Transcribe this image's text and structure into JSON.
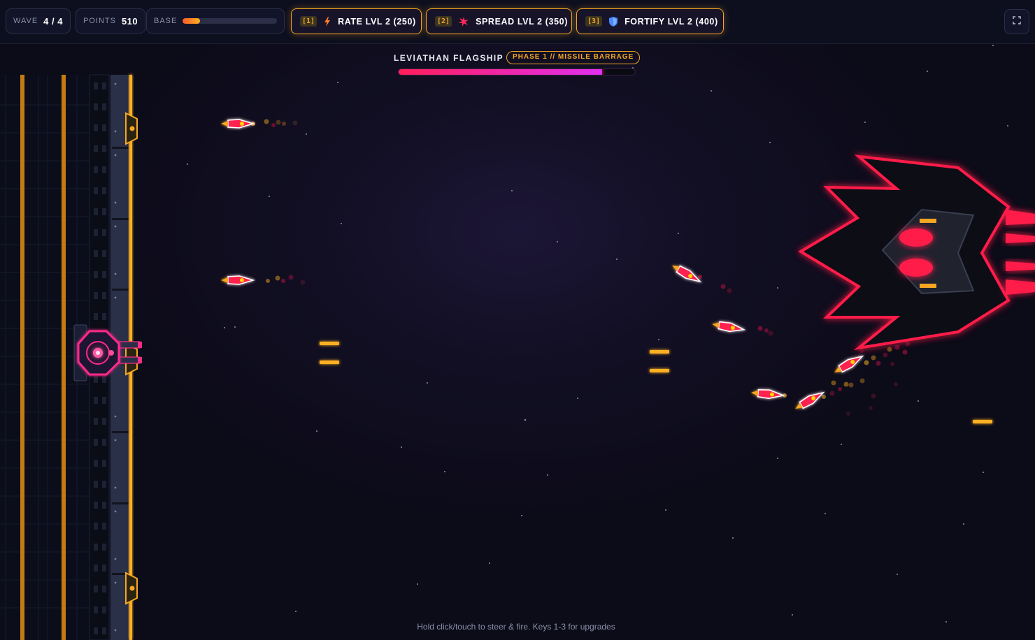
{
  "hud": {
    "wave": {
      "label": "WAVE",
      "value": "4 / 4"
    },
    "points": {
      "label": "POINTS",
      "value": "510"
    },
    "base": {
      "label": "BASE",
      "health_fraction": 0.18
    },
    "upgrades": [
      {
        "key": "[1]",
        "icon": "lightning-icon",
        "label": "RATE  LVL 2 (250)"
      },
      {
        "key": "[2]",
        "icon": "burst-icon",
        "label": "SPREAD  LVL 2 (350)"
      },
      {
        "key": "[3]",
        "icon": "shield-icon",
        "label": "FORTIFY  LVL 2 (400)"
      }
    ],
    "fullscreen_icon": "fullscreen-icon"
  },
  "boss": {
    "name": "LEVIATHAN FLAGSHIP",
    "phase": "PHASE 1 // MISSILE BARRAGE",
    "health_fraction": 0.86
  },
  "hint": "Hold click/touch to steer & fire. Keys 1-3 for upgrades",
  "colors": {
    "accent": "#f5a623",
    "enemy": "#ff1e5a",
    "boss_bar": "#e030f0",
    "background": "#0c0b18"
  }
}
